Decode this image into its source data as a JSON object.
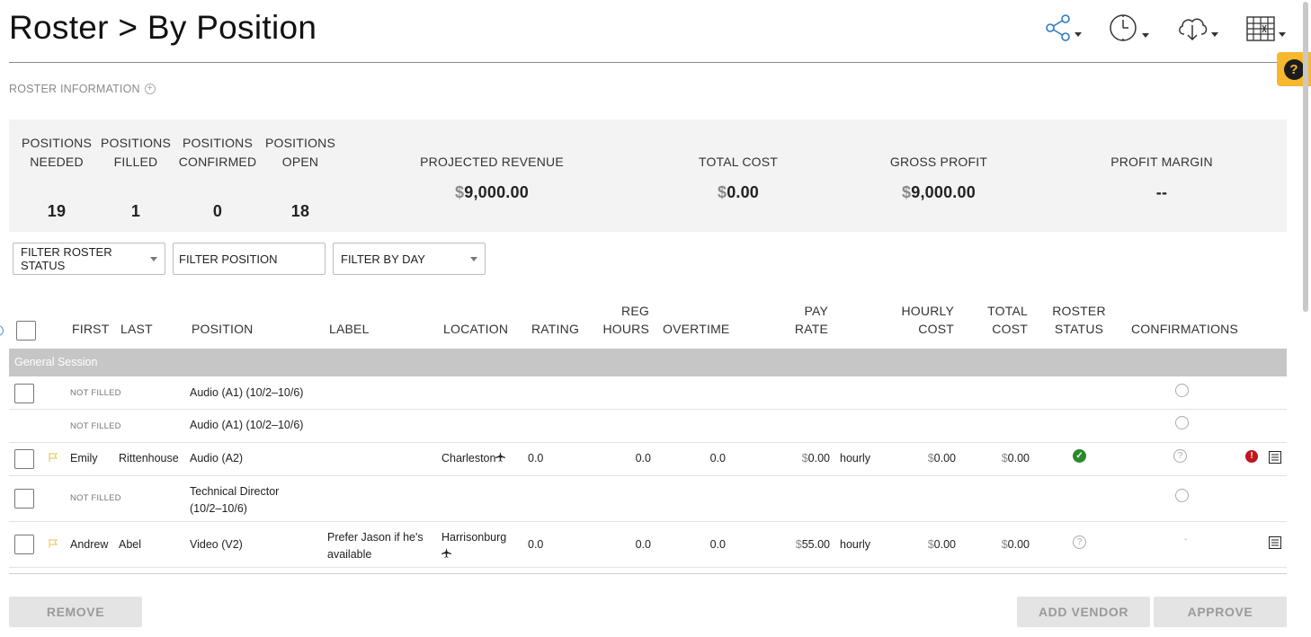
{
  "page": {
    "title": "Roster > By Position"
  },
  "toolbar": {
    "share_icon": "share-icon",
    "history_icon": "clock-icon",
    "cloud_icon": "cloud-download-icon",
    "grid_icon": "spreadsheet-icon"
  },
  "help": {
    "label": "?"
  },
  "roster_info": {
    "label": "ROSTER INFORMATION",
    "expand_symbol": "+"
  },
  "stats": {
    "needed": {
      "line1": "POSITIONS",
      "line2": "NEEDED",
      "value": "19"
    },
    "filled": {
      "line1": "POSITIONS",
      "line2": "FILLED",
      "value": "1"
    },
    "confirmed": {
      "line1": "POSITIONS",
      "line2": "CONFIRMED",
      "value": "0"
    },
    "open": {
      "line1": "POSITIONS",
      "line2": "OPEN",
      "value": "18"
    },
    "revenue": {
      "label": "PROJECTED REVENUE",
      "currency": "$",
      "value": "9,000.00"
    },
    "total_cost": {
      "label": "TOTAL COST",
      "currency": "$",
      "value": "0.00"
    },
    "gross_profit": {
      "label": "GROSS PROFIT",
      "currency": "$",
      "value": "9,000.00"
    },
    "profit_margin": {
      "label": "PROFIT MARGIN",
      "value": "--"
    }
  },
  "filters": {
    "roster_status": "FILTER ROSTER STATUS",
    "position": "FILTER POSITION",
    "by_day": "FILTER BY DAY"
  },
  "table": {
    "headers": {
      "first": "FIRST",
      "last": "LAST",
      "position": "POSITION",
      "label": "LABEL",
      "location": "LOCATION",
      "rating": "RATING",
      "reg_hours_1": "REG",
      "reg_hours_2": "HOURS",
      "overtime": "OVERTIME",
      "pay_rate_1": "PAY",
      "pay_rate_2": "RATE",
      "hourly_cost_1": "HOURLY",
      "hourly_cost_2": "COST",
      "total_cost_1": "TOTAL",
      "total_cost_2": "COST",
      "roster_status_1": "ROSTER",
      "roster_status_2": "STATUS",
      "confirmations": "CONFIRMATIONS"
    },
    "group": "General Session",
    "rows": [
      {
        "status_text": "NOT FILLED",
        "position": "Audio (A1) (10/2–10/6)"
      },
      {
        "status_text": "NOT FILLED",
        "position": "Audio (A1) (10/2–10/6)"
      },
      {
        "first": "Emily",
        "last": "Rittenhouse",
        "position": "Audio (A2)",
        "location": "Charleston",
        "rating": "0.0",
        "reg_hours": "0.0",
        "overtime": "0.0",
        "pay_currency": "$",
        "pay_rate": "0.00",
        "pay_unit": "hourly",
        "hourly_currency": "$",
        "hourly_cost": "0.00",
        "total_currency": "$",
        "total_cost": "0.00",
        "status_icon": "check-icon",
        "confirm_icon": "question-icon",
        "alert": "!"
      },
      {
        "status_text": "NOT FILLED",
        "position_line1": "Technical Director",
        "position_line2": "(10/2–10/6)"
      },
      {
        "first": "Andrew",
        "last": "Abel",
        "position": "Video (V2)",
        "label_line1": "Prefer Jason if he's",
        "label_line2": "available",
        "location": "Harrisonburg",
        "rating": "0.0",
        "reg_hours": "0.0",
        "overtime": "0.0",
        "pay_currency": "$",
        "pay_rate": "55.00",
        "pay_unit": "hourly",
        "hourly_currency": "$",
        "hourly_cost": "0.00",
        "total_currency": "$",
        "total_cost": "0.00",
        "status_icon": "question-icon",
        "confirm_text": "-"
      }
    ],
    "status_glyphs": {
      "check": "✓",
      "question": "?"
    }
  },
  "actions": {
    "remove": "REMOVE",
    "add_vendor": "ADD VENDOR",
    "approve": "APPROVE"
  }
}
